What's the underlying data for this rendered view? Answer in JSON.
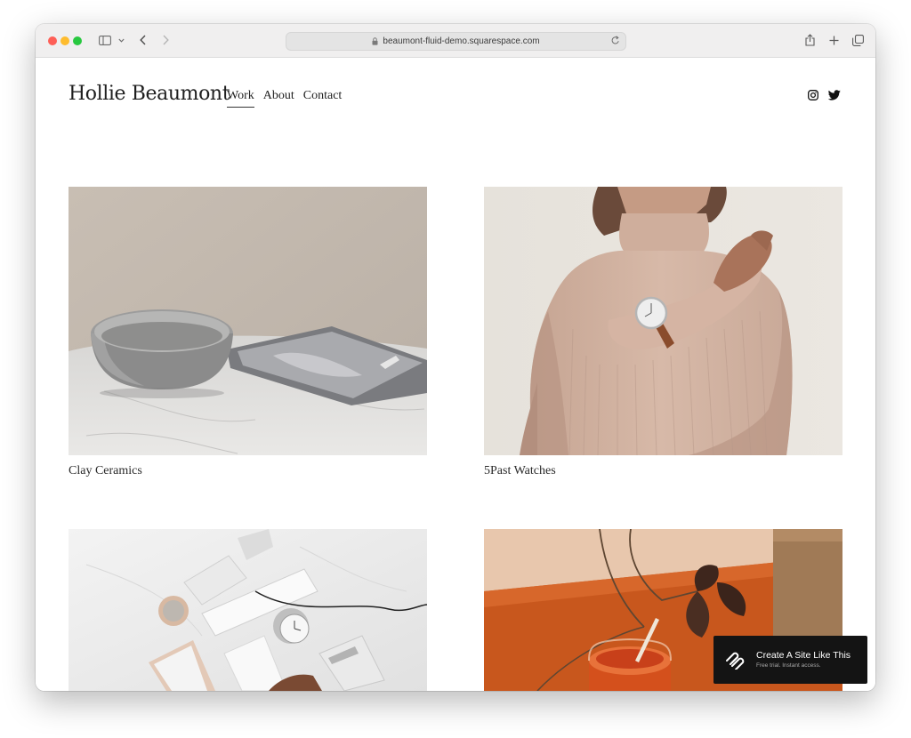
{
  "browser": {
    "url": "beaumont-fluid-demo.squarespace.com",
    "icons": [
      "sidebar-icon",
      "chevron-down-icon",
      "back-icon",
      "forward-icon",
      "lock-icon",
      "reload-icon",
      "share-icon",
      "new-tab-icon",
      "tabs-icon"
    ]
  },
  "site": {
    "logo": "Hollie Beaumont",
    "nav": [
      {
        "label": "Work",
        "active": true
      },
      {
        "label": "About",
        "active": false
      },
      {
        "label": "Contact",
        "active": false
      }
    ],
    "social": [
      "instagram-icon",
      "twitter-icon"
    ]
  },
  "projects": [
    {
      "title": "Clay Ceramics",
      "image": "bowl-and-marble-tray-photo"
    },
    {
      "title": "5Past Watches",
      "image": "woman-wearing-watch-photo"
    },
    {
      "title": "",
      "image": "desk-accessories-flatlay-photo"
    },
    {
      "title": "",
      "image": "orange-drink-still-life-photo"
    }
  ],
  "cta": {
    "title": "Create A Site Like This",
    "subtitle": "Free trial. Instant access."
  },
  "colors": {
    "toolbar": "#f0efef",
    "text": "#1f1f1f",
    "cta_bg": "#141414"
  }
}
